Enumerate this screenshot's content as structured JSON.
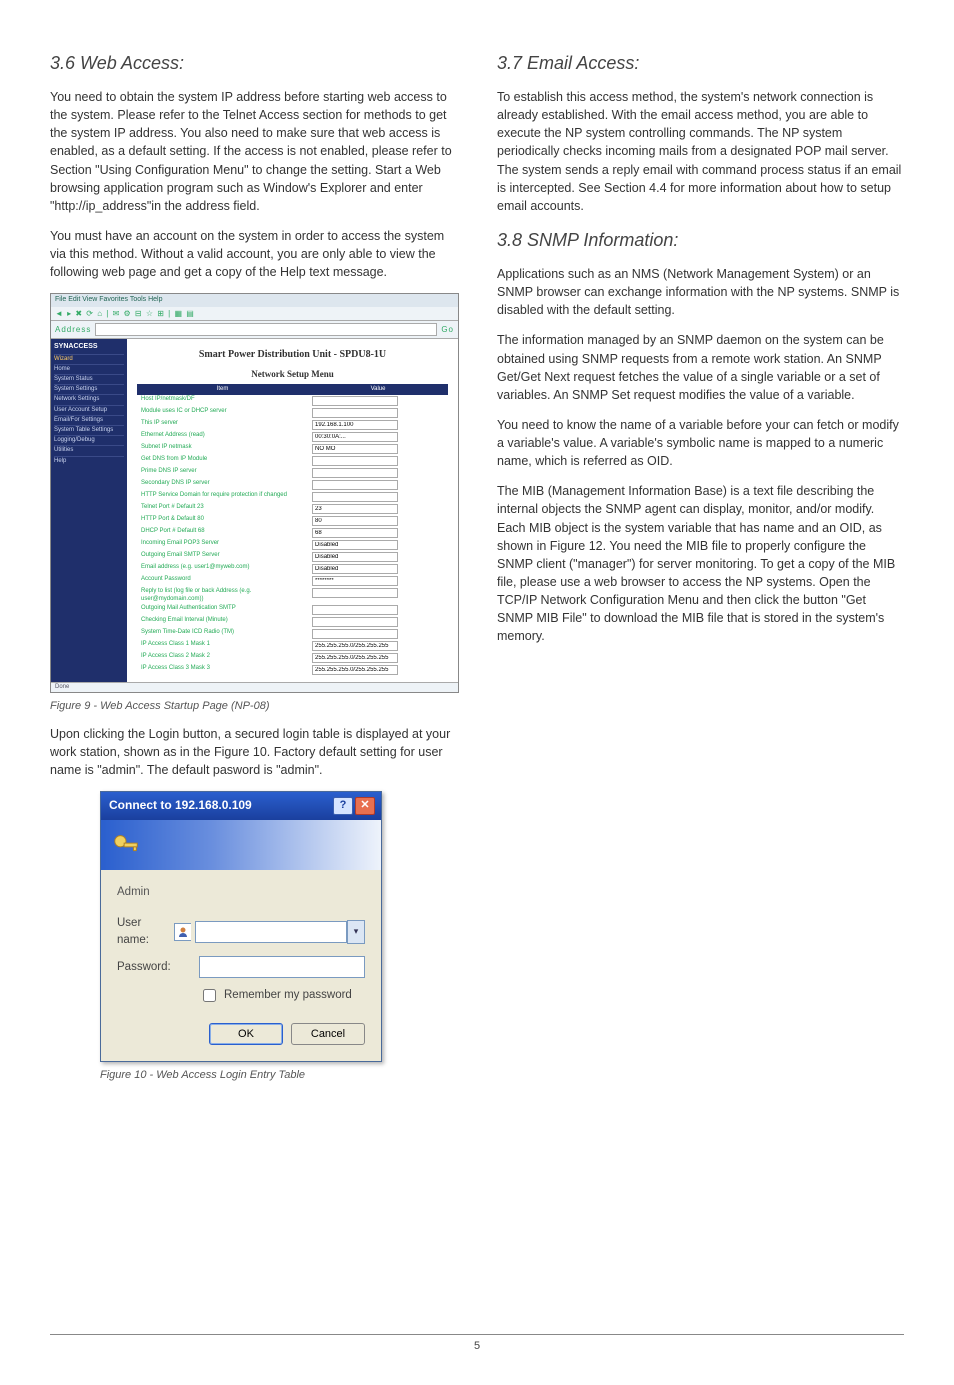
{
  "left": {
    "h36": "3.6  Web Access:",
    "p1": "You need to obtain the system IP address before starting web access to the system. Please refer to the Telnet Access section for methods to get the system IP address. You also need to make sure that web access is enabled, as a default setting. If the access is not enabled, please refer to Section \"Using Configuration Menu\" to change the setting. Start a Web browsing application program such as Window's Explorer and enter \"http://ip_address\"in the address field.",
    "p2": "You must have an account on the system in order to access the system via this method. Without a valid account, you are only able to view the following web page and get a copy of the Help text message.",
    "fig9_caption": "Figure 9 - Web Access Startup Page (NP-08)",
    "p3": "Upon clicking the Login button, a secured login table is displayed at your work station, shown as in the Figure 10. Factory default setting for user name is \"admin\". The default pasword is \"admin\".",
    "fig10_caption": "Figure 10 - Web Access Login Entry Table"
  },
  "right": {
    "h37": "3.7  Email Access:",
    "p1": "To establish this access method, the system's network connection is already established. With the email access method, you are able to execute the NP system controlling commands. The NP system periodically checks incoming mails from a designated POP mail server. The system sends a reply email with command process status if an email is intercepted. See Section 4.4 for more information about how to setup email accounts.",
    "h38": "3.8  SNMP Information:",
    "p2": "Applications such as an NMS (Network Management System) or an SNMP browser can exchange information with the NP systems. SNMP is disabled with the default setting.",
    "p3": "The information managed by an SNMP daemon on the system can be obtained using SNMP requests from a remote work station. An SNMP Get/Get Next request fetches the value of a single variable or a set of variables. An SNMP Set request modifies the value of a variable.",
    "p4": "You need to know the name of a variable before your can fetch or modify a variable's value. A variable's symbolic name is mapped to a numeric name, which is referred as OID.",
    "p5": "The MIB (Management Information Base) is a text file describing the internal objects the SNMP agent can display, monitor, and/or modify.  Each MIB object is the system variable that has name and an OID, as shown in Figure 12. You need the MIB file to properly configure the SNMP client (\"manager\") for server monitoring. To get a copy of the MIB file, please use a web browser to access the NP systems. Open the TCP/IP Network Configuration Menu and then click the button \"Get SNMP MIB File\" to download the MIB file that is stored in the system's memory."
  },
  "fig9": {
    "menubar": "File  Edit  View  Favorites  Tools  Help",
    "toolbar": "◄ ▸ ✖ ⟳ ⌂ | ✉ ⚙ ⊟ ☆ ⊞ | ▦ ▤",
    "address_label": "Address",
    "go": "Go",
    "brand": "SYNACCESS",
    "wizard": "Wizard",
    "nav": [
      "Home",
      "System Status",
      "System Settings",
      "Network Settings",
      "User Account Setup",
      "Email/For Settings",
      "System Table Settings",
      "Logging/Debug",
      "Utilities",
      "Help"
    ],
    "heading": "Smart Power Distribution Unit - SPDU8-1U",
    "subheading": "Network Setup Menu",
    "col_item": "Item",
    "col_value": "Value",
    "rows": [
      {
        "k": "Host IP/netmask/DF",
        "v": ""
      },
      {
        "k": "Module uses IC or DHCP server",
        "v": ""
      },
      {
        "k": "This IP server",
        "v": "192.168.1.100"
      },
      {
        "k": "Ethernet Address (read)",
        "v": "00:30:0A:..."
      },
      {
        "k": "Subnet IP netmask",
        "v": "NO MO"
      },
      {
        "k": "Get DNS from IP Module",
        "v": ""
      },
      {
        "k": "Prime DNS IP server",
        "v": ""
      },
      {
        "k": "Secondary DNS IP server",
        "v": ""
      },
      {
        "k": "HTTP Service Domain for require protection if changed",
        "v": ""
      },
      {
        "k": "Telnet Port # Default 23",
        "v": "23"
      },
      {
        "k": "HTTP Port & Default 80",
        "v": "80"
      },
      {
        "k": "DHCP Port # Default 68",
        "v": "68"
      },
      {
        "k": "Incoming Email POP3 Server",
        "v": "Disabled"
      },
      {
        "k": "Outgoing Email SMTP Server",
        "v": "Disabled"
      },
      {
        "k": "Email address (e.g. user1@myweb.com)",
        "v": "Disabled"
      },
      {
        "k": "Account Password",
        "v": "********"
      },
      {
        "k": "Reply to list (log file or back Address (e.g. user@mydomain.com))",
        "v": ""
      },
      {
        "k": "Outgoing Mail Authentication SMTP",
        "v": ""
      },
      {
        "k": "Checking Email Interval (Minute)",
        "v": ""
      },
      {
        "k": "System Time-Date ICD Radio (TM)",
        "v": ""
      },
      {
        "k": "IP Access Class 1 Mask 1",
        "v": "255.255.255.0/255.255.255"
      },
      {
        "k": "IP Access Class 2 Mask 2",
        "v": "255.255.255.0/255.255.255"
      },
      {
        "k": "IP Access Class 3 Mask 3",
        "v": "255.255.255.0/255.255.255"
      }
    ],
    "status": "Done"
  },
  "fig10": {
    "title": "Connect to 192.168.0.109",
    "realm": "Admin",
    "user_label": "User name:",
    "pass_label": "Password:",
    "remember": "Remember my password",
    "ok": "OK",
    "cancel": "Cancel"
  },
  "footer": {
    "page": "5"
  }
}
